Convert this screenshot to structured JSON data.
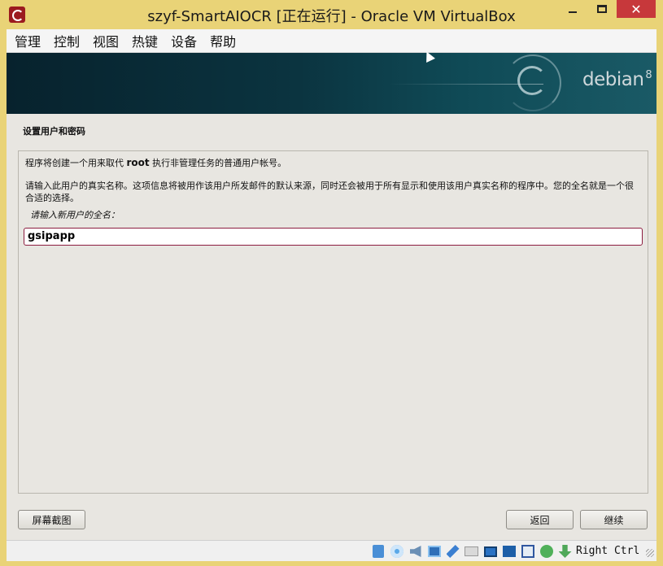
{
  "window": {
    "title": "szyf-SmartAIOCR [正在运行] - Oracle VM VirtualBox",
    "close_glyph": "✕"
  },
  "menu": {
    "items": [
      "管理",
      "控制",
      "视图",
      "热键",
      "设备",
      "帮助"
    ]
  },
  "banner": {
    "logo_text": "debian",
    "logo_version": "8"
  },
  "installer": {
    "section_title": "设置用户和密码",
    "description_1_prefix": "程序将创建一个用来取代 ",
    "description_1_code": "root",
    "description_1_suffix": " 执行非管理任务的普通用户帐号。",
    "description_2": "请输入此用户的真实名称。这项信息将被用作该用户所发邮件的默认来源，同时还会被用于所有显示和使用该用户真实名称的程序中。您的全名就是一个很合适的选择。",
    "prompt": "请输入新用户的全名：",
    "full_name_value": "gsipapp"
  },
  "buttons": {
    "screenshot": "屏幕截图",
    "back": "返回",
    "continue": "继续"
  },
  "statusbar": {
    "host_key": "Right Ctrl",
    "icons": [
      "hard-disk-icon",
      "optical-drive-icon",
      "audio-icon",
      "network-icon",
      "usb-icon",
      "shared-folders-icon",
      "display-icon",
      "video-capture-icon",
      "virtualization-icon",
      "mouse-integration-icon",
      "keyboard-capture-icon"
    ]
  },
  "colors": {
    "frame": "#e9d377",
    "close_button": "#c7383b",
    "banner_dark": "#07222d",
    "input_border": "#8c1d40"
  }
}
